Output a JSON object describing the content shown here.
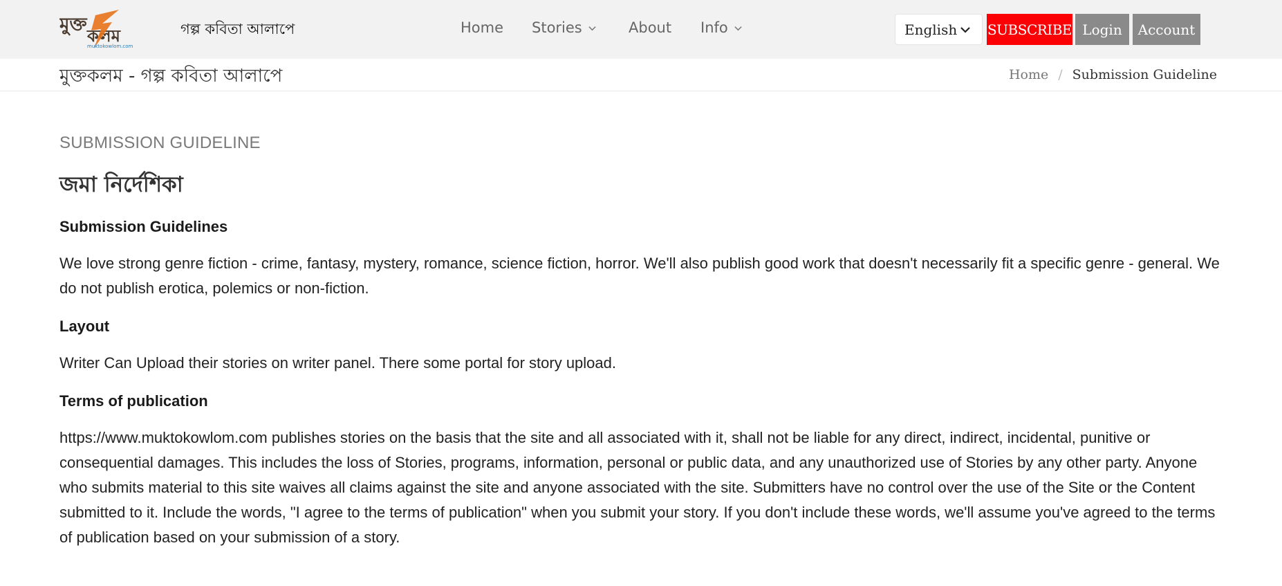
{
  "header": {
    "logo_text": "মুক্তকলম",
    "logo_subtext": "muktokowlom.com",
    "tagline": "গল্প কবিতা আলাপে",
    "nav": [
      {
        "label": "Home",
        "has_dropdown": false
      },
      {
        "label": "Stories",
        "has_dropdown": true
      },
      {
        "label": "About",
        "has_dropdown": false
      },
      {
        "label": "Info",
        "has_dropdown": true
      }
    ],
    "language": "English",
    "subscribe_label": "SUBSCRIBE",
    "login_label": "Login",
    "account_label": "Account"
  },
  "subbar": {
    "site_title": "মুক্তকলম - গল্প কবিতা আলাপে",
    "breadcrumb": {
      "home": "Home",
      "separator": "/",
      "current": "Submission Guideline"
    }
  },
  "content": {
    "eyebrow": "SUBMISSION GUIDELINE",
    "heading_bn": "জমা নির্দেশিকা",
    "sections": [
      {
        "title": "Submission Guidelines",
        "body": "We love strong genre fiction - crime, fantasy, mystery, romance, science fiction, horror. We'll also publish good work that doesn't necessarily fit a specific genre - general. We do not publish erotica, polemics or non-fiction."
      },
      {
        "title": "Layout",
        "body": "Writer Can Upload their stories on writer panel. There some portal for story upload."
      },
      {
        "title": "Terms of publication",
        "body": "https://www.muktokowlom.com publishes stories on the basis that the site and all associated with it, shall not be liable for any direct, indirect, incidental, punitive or consequential damages. This includes the loss of Stories, programs, information, personal or public data, and any unauthorized use of Stories by any other party. Anyone who submits material to this site waives all claims against the site and anyone associated with the site. Submitters have no control over the use of the Site or the Content submitted to it. Include the words, \"I agree to the terms of publication\" when you submit your story. If you don't include these words, we'll assume you've agreed to the terms of publication based on your submission of a story."
      }
    ]
  },
  "colors": {
    "topbar_bg": "#f2f2f2",
    "subscribe_bg": "#fb0004",
    "button_gray": "#8a8a8a",
    "logo_orange": "#e8731a",
    "logo_brown": "#4a3a2e"
  }
}
